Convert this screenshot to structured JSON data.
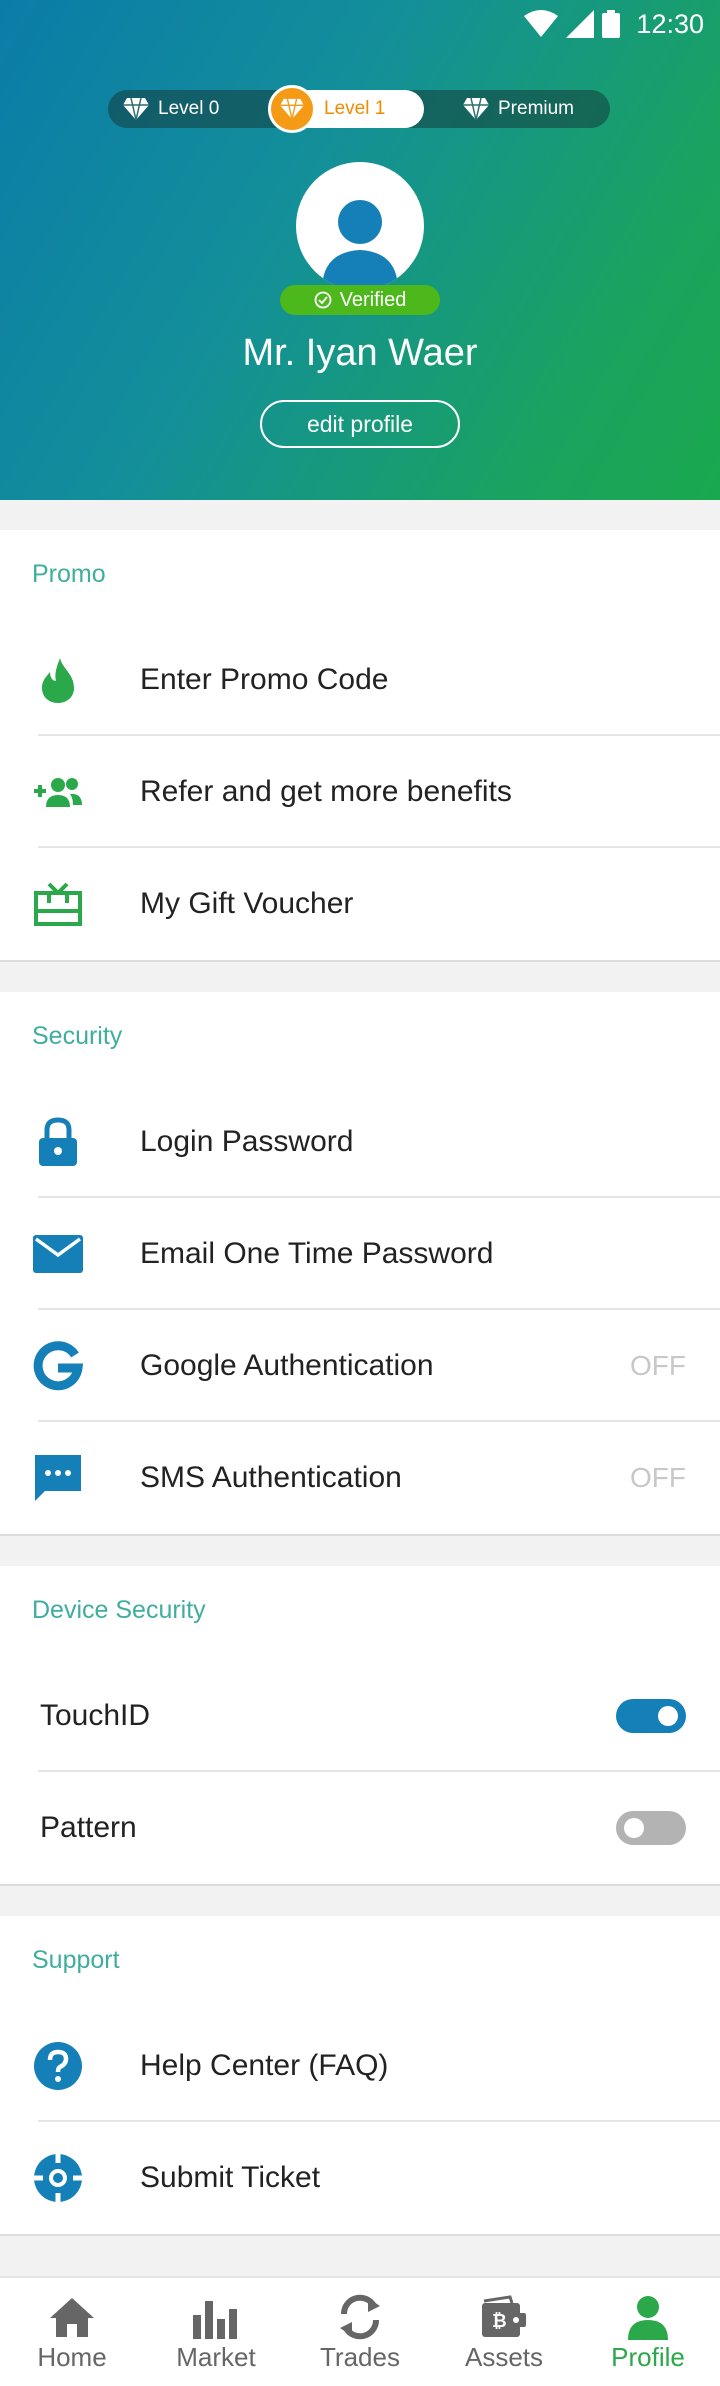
{
  "status_bar": {
    "time": "12:30"
  },
  "header": {
    "levels": [
      {
        "label": "Level 0",
        "icon": "diamond-icon"
      },
      {
        "label": "Level 1",
        "icon": "diamond-icon",
        "active": true
      },
      {
        "label": "Premium",
        "icon": "diamond-icon"
      }
    ],
    "verified_label": "Verified",
    "user_name": "Mr. Iyan Waer",
    "edit_profile_label": "edit profile"
  },
  "promo": {
    "title": "Promo",
    "items": [
      {
        "label": "Enter Promo Code",
        "icon": "flame-icon"
      },
      {
        "label": "Refer and get more benefits",
        "icon": "add-people-icon"
      },
      {
        "label": "My Gift Voucher",
        "icon": "gift-icon"
      }
    ]
  },
  "security": {
    "title": "Security",
    "items": [
      {
        "label": "Login Password",
        "icon": "lock-icon"
      },
      {
        "label": "Email One Time Password",
        "icon": "mail-icon"
      },
      {
        "label": "Google Authentication",
        "icon": "google-icon",
        "state": "OFF"
      },
      {
        "label": "SMS Authentication",
        "icon": "sms-icon",
        "state": "OFF"
      }
    ]
  },
  "device_security": {
    "title": "Device Security",
    "items": [
      {
        "label": "TouchID",
        "enabled": true
      },
      {
        "label": "Pattern",
        "enabled": false
      }
    ]
  },
  "support": {
    "title": "Support",
    "items": [
      {
        "label": "Help Center (FAQ)",
        "icon": "help-icon"
      },
      {
        "label": "Submit Ticket",
        "icon": "lifebuoy-icon"
      }
    ]
  },
  "nav": {
    "items": [
      {
        "label": "Home",
        "icon": "home-icon"
      },
      {
        "label": "Market",
        "icon": "bar-chart-icon"
      },
      {
        "label": "Trades",
        "icon": "sync-icon"
      },
      {
        "label": "Assets",
        "icon": "wallet-icon"
      },
      {
        "label": "Profile",
        "icon": "person-icon",
        "active": true
      }
    ]
  },
  "colors": {
    "accent_blue": "#1580b8",
    "accent_green": "#2aa84a",
    "section_title": "#3fae9e",
    "level_active": "#f59a14",
    "verified": "#4cb81c"
  }
}
